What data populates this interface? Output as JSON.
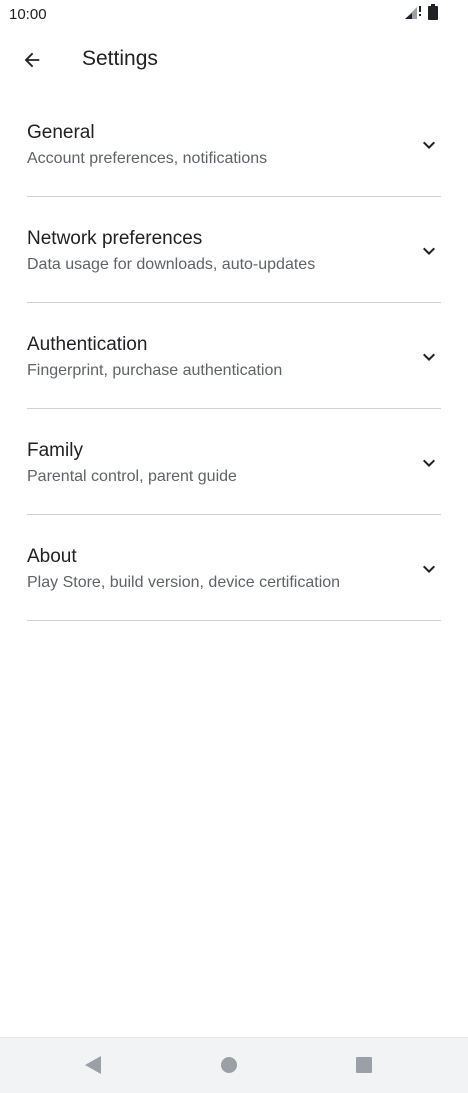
{
  "status_bar": {
    "time": "10:00",
    "icons": [
      "signal-icon",
      "battery-icon"
    ]
  },
  "header": {
    "back_icon": "arrow-left-icon",
    "title": "Settings"
  },
  "settings": {
    "items": [
      {
        "title": "General",
        "subtitle": "Account preferences, notifications"
      },
      {
        "title": "Network preferences",
        "subtitle": "Data usage for downloads, auto-updates"
      },
      {
        "title": "Authentication",
        "subtitle": "Fingerprint, purchase authentication"
      },
      {
        "title": "Family",
        "subtitle": "Parental control, parent guide"
      },
      {
        "title": "About",
        "subtitle": "Play Store, build version, device certification"
      }
    ],
    "expand_icon": "chevron-down-icon"
  },
  "nav_bar": {
    "buttons": [
      "back-triangle-icon",
      "home-circle-icon",
      "recents-square-icon"
    ]
  },
  "colors": {
    "text_primary": "#202124",
    "text_secondary": "#5f6368",
    "divider": "#cfd1d4",
    "nav_bar_bg": "#f1f3f4",
    "nav_icon": "#9aa0a6"
  }
}
